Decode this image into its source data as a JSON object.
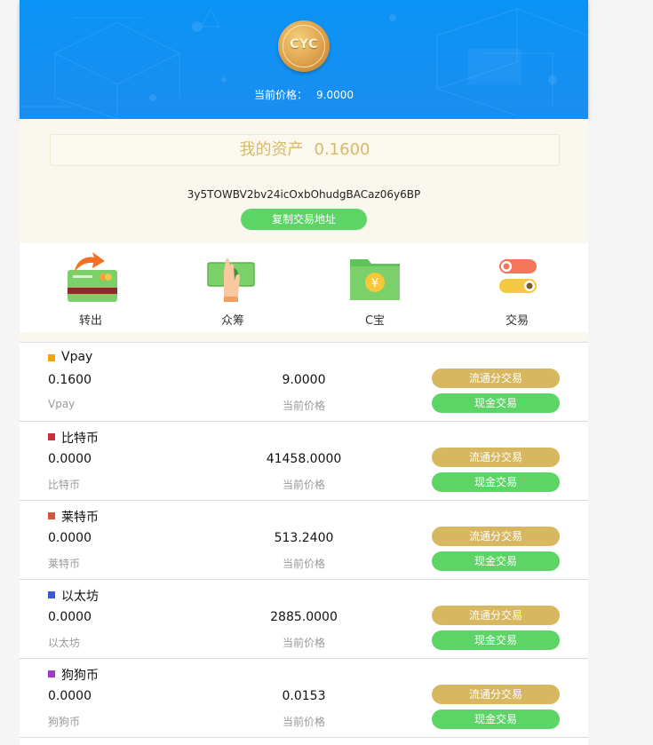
{
  "header": {
    "coin_logo_text": "CYC",
    "price_label": "当前价格：",
    "price_value": "9.0000",
    "bg_color": "#0a93f6"
  },
  "assets": {
    "label": "我的资产",
    "amount": "0.1600",
    "address": "3y5TOWBV2bv24icOxbOhudgBACaz06y6BP",
    "copy_button": "复制交易地址"
  },
  "menu": [
    {
      "label": "转出",
      "icon": "transfer-out-card-icon"
    },
    {
      "label": "众筹",
      "icon": "crowdfunding-money-icon"
    },
    {
      "label": "C宝",
      "icon": "wallet-folder-yuan-icon"
    },
    {
      "label": "交易",
      "icon": "trade-toggle-icon"
    }
  ],
  "coins": [
    {
      "name": "Vpay",
      "color": "#f0a30a",
      "balance": "0.1600",
      "sub": "Vpay",
      "price": "9.0000",
      "price_label": "当前价格",
      "flow_btn": "流通分交易",
      "cash_btn": "现金交易"
    },
    {
      "name": "比特币",
      "color": "#c8323c",
      "balance": "0.0000",
      "sub": "比特币",
      "price": "41458.0000",
      "price_label": "当前价格",
      "flow_btn": "流通分交易",
      "cash_btn": "现金交易"
    },
    {
      "name": "莱特币",
      "color": "#d2553c",
      "balance": "0.0000",
      "sub": "莱特币",
      "price": "513.2400",
      "price_label": "当前价格",
      "flow_btn": "流通分交易",
      "cash_btn": "现金交易"
    },
    {
      "name": "以太坊",
      "color": "#3c5ac8",
      "balance": "0.0000",
      "sub": "以太坊",
      "price": "2885.0000",
      "price_label": "当前价格",
      "flow_btn": "流通分交易",
      "cash_btn": "现金交易"
    },
    {
      "name": "狗狗币",
      "color": "#9b3cc8",
      "balance": "0.0000",
      "sub": "狗狗币",
      "price": "0.0153",
      "price_label": "当前价格",
      "flow_btn": "流通分交易",
      "cash_btn": "现金交易"
    }
  ]
}
